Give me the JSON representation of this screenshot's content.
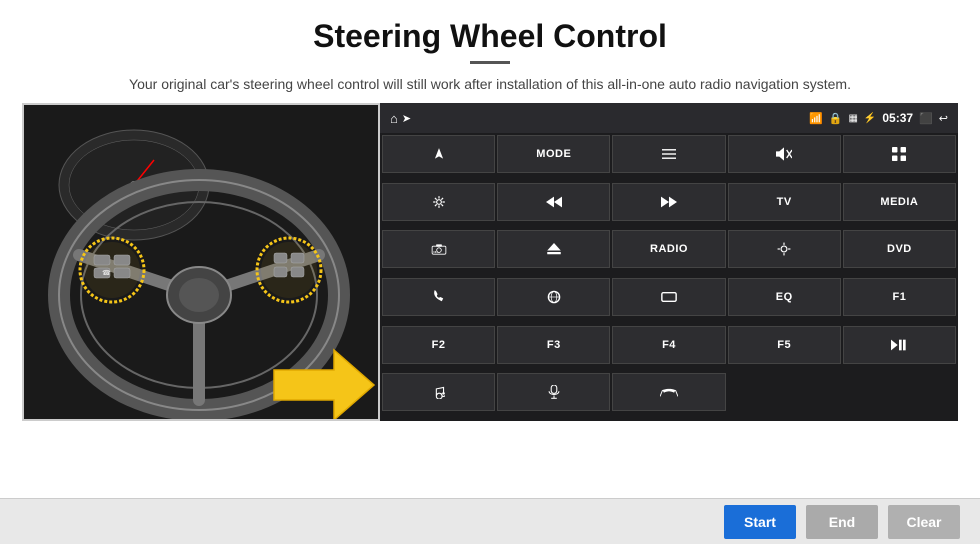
{
  "header": {
    "title": "Steering Wheel Control",
    "divider": true,
    "subtitle": "Your original car's steering wheel control will still work after installation of this all-in-one auto radio navigation system."
  },
  "status_bar": {
    "home_icon": "⌂",
    "wifi_icon": "wifi",
    "lock_icon": "lock",
    "sim_icon": "sim",
    "bluetooth_icon": "bt",
    "time": "05:37",
    "screen_icon": "screen",
    "back_icon": "back"
  },
  "buttons": [
    {
      "id": "nav",
      "label": "➤",
      "row": 1
    },
    {
      "id": "mode",
      "label": "MODE",
      "row": 1
    },
    {
      "id": "list",
      "label": "☰",
      "row": 1
    },
    {
      "id": "mute",
      "label": "🔇",
      "row": 1
    },
    {
      "id": "apps",
      "label": "⊞",
      "row": 1
    },
    {
      "id": "settings",
      "label": "⚙",
      "row": 2
    },
    {
      "id": "prev",
      "label": "◀◀",
      "row": 2
    },
    {
      "id": "next",
      "label": "▶▶",
      "row": 2
    },
    {
      "id": "tv",
      "label": "TV",
      "row": 2
    },
    {
      "id": "media",
      "label": "MEDIA",
      "row": 2
    },
    {
      "id": "cam360",
      "label": "360",
      "row": 3
    },
    {
      "id": "eject",
      "label": "▲",
      "row": 3
    },
    {
      "id": "radio",
      "label": "RADIO",
      "row": 3
    },
    {
      "id": "brightness",
      "label": "☀",
      "row": 3
    },
    {
      "id": "dvd",
      "label": "DVD",
      "row": 3
    },
    {
      "id": "phone",
      "label": "📞",
      "row": 4
    },
    {
      "id": "browse",
      "label": "◎",
      "row": 4
    },
    {
      "id": "window",
      "label": "▭",
      "row": 4
    },
    {
      "id": "eq",
      "label": "EQ",
      "row": 4
    },
    {
      "id": "f1",
      "label": "F1",
      "row": 4
    },
    {
      "id": "f2",
      "label": "F2",
      "row": 5
    },
    {
      "id": "f3",
      "label": "F3",
      "row": 5
    },
    {
      "id": "f4",
      "label": "F4",
      "row": 5
    },
    {
      "id": "f5",
      "label": "F5",
      "row": 5
    },
    {
      "id": "playpause",
      "label": "▶❚❚",
      "row": 5
    },
    {
      "id": "music",
      "label": "♪",
      "row": 6
    },
    {
      "id": "mic",
      "label": "🎤",
      "row": 6
    },
    {
      "id": "hangup",
      "label": "📵",
      "row": 6
    }
  ],
  "bottom_bar": {
    "start_label": "Start",
    "end_label": "End",
    "clear_label": "Clear"
  }
}
